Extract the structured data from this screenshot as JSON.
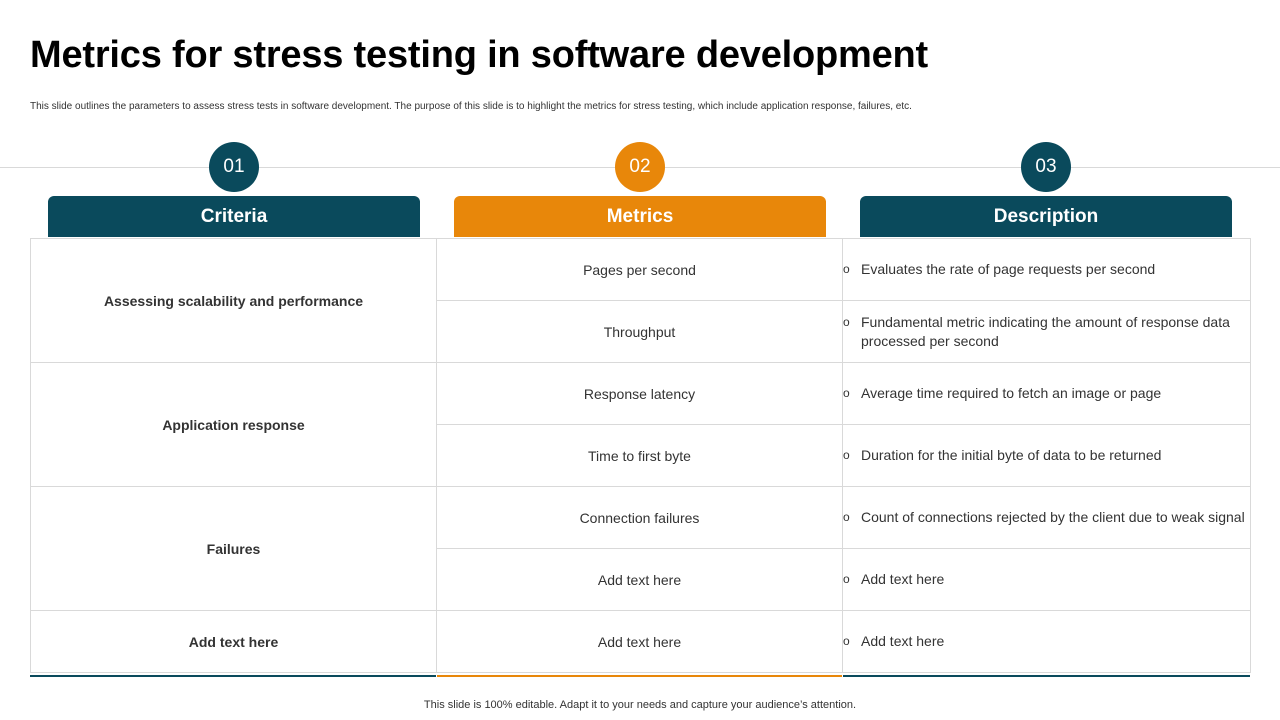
{
  "title": "Metrics for stress testing in software development",
  "subtitle": "This slide outlines the parameters to assess stress tests in software development. The purpose of this slide is to highlight the metrics for stress testing, which include application response, failures, etc.",
  "columns": [
    {
      "number": "01",
      "label": "Criteria"
    },
    {
      "number": "02",
      "label": "Metrics"
    },
    {
      "number": "03",
      "label": "Description"
    }
  ],
  "groups": [
    {
      "criteria": "Assessing scalability and performance",
      "rows": [
        {
          "metric": "Pages per second",
          "description": "Evaluates the rate of page requests per second"
        },
        {
          "metric": "Throughput",
          "description": "Fundamental metric indicating the amount of response data processed per second"
        }
      ]
    },
    {
      "criteria": "Application response",
      "rows": [
        {
          "metric": "Response latency",
          "description": "Average time required to fetch an image or page"
        },
        {
          "metric": "Time to first byte",
          "description": "Duration for the initial byte of data to be returned"
        }
      ]
    },
    {
      "criteria": "Failures",
      "rows": [
        {
          "metric": "Connection failures",
          "description": "Count of connections rejected by the client due to weak signal"
        },
        {
          "metric": "Add text here",
          "description": "Add text here"
        }
      ]
    },
    {
      "criteria": "Add text here",
      "rows": [
        {
          "metric": "Add text here",
          "description": "Add text here"
        }
      ]
    }
  ],
  "bullet_glyph": "o",
  "footer": "This slide is 100% editable. Adapt it to your needs and capture your audience’s attention.",
  "colors": {
    "teal": "#0a4a5c",
    "orange": "#e8870a",
    "border": "#d9d9d9"
  }
}
